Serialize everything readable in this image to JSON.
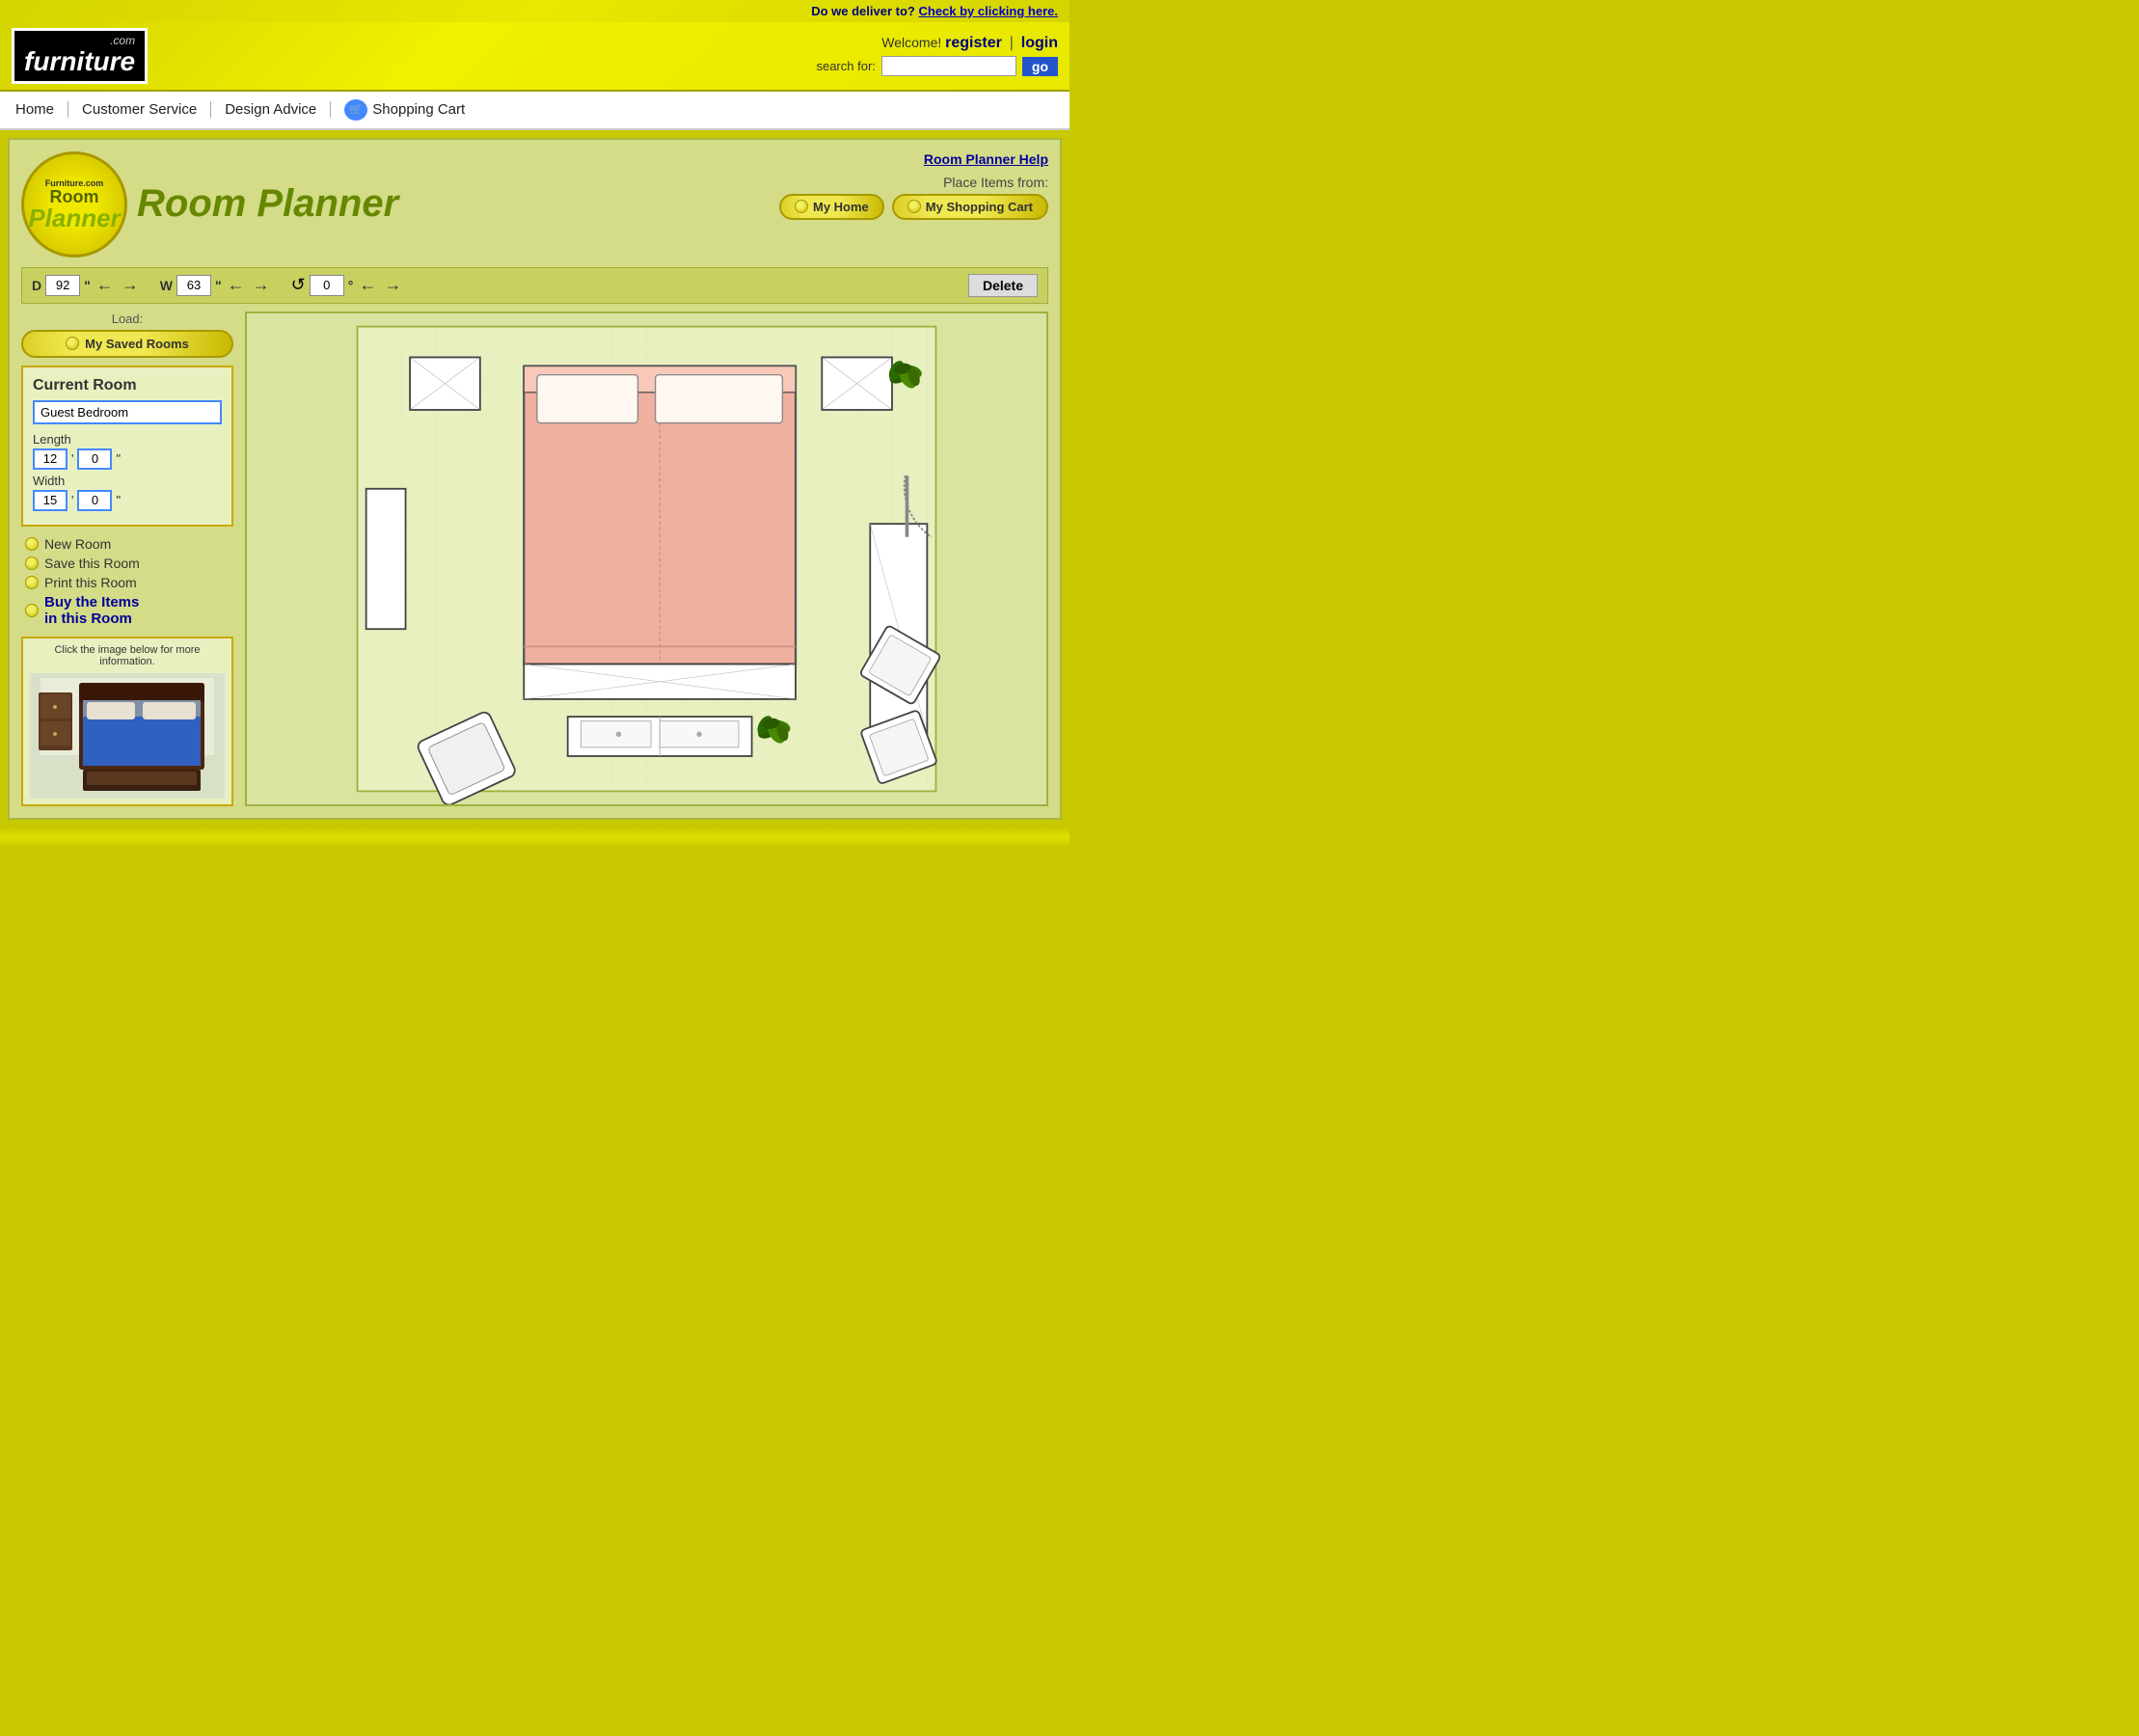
{
  "delivery": {
    "label": "Do we deliver to?",
    "link": "Check by clicking here."
  },
  "header": {
    "logo_top": ".com",
    "logo_main": "furniture",
    "welcome": "Welcome!",
    "register": "register",
    "separator": "|",
    "login": "login",
    "search_label": "search for:",
    "search_placeholder": "",
    "go_btn": "go"
  },
  "nav": {
    "items": [
      {
        "label": "Home",
        "id": "home"
      },
      {
        "label": "Customer Service",
        "id": "customer-service"
      },
      {
        "label": "Design Advice",
        "id": "design-advice"
      },
      {
        "label": "Shopping Cart",
        "id": "shopping-cart"
      }
    ]
  },
  "room_planner": {
    "help_link": "Room Planner Help",
    "place_items_label": "Place Items from:",
    "my_home_btn": "My Home",
    "my_shopping_cart_btn": "My Shopping Cart",
    "logo_furniture_com": "Furniture.com",
    "logo_room": "Room",
    "logo_planner": "Planner",
    "controls": {
      "depth_label": "D",
      "depth_value": "92",
      "depth_unit": "\"",
      "width_label": "W",
      "width_value": "63",
      "width_unit": "\"",
      "rotate_value": "0",
      "rotate_unit": "°",
      "delete_label": "Delete"
    },
    "load": {
      "label": "Load:",
      "btn": "My Saved Rooms"
    },
    "current_room": {
      "title": "Current Room",
      "name": "Guest Bedroom",
      "length_label": "Length",
      "length_feet": "12",
      "length_inches": "0",
      "width_label": "Width",
      "width_feet": "15",
      "width_inches": "0",
      "unit": "\""
    },
    "actions": {
      "new_room": "New Room",
      "save_room": "Save this Room",
      "print_room": "Print this Room",
      "buy_items": "Buy the Items\nin this Room"
    },
    "info_box": {
      "message": "Click the image below for more information."
    }
  }
}
